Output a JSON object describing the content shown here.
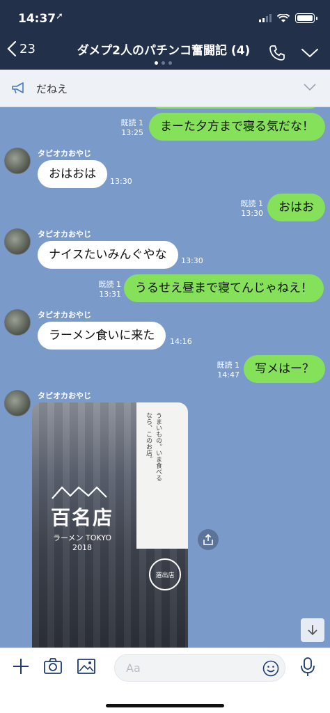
{
  "status": {
    "time": "14:37",
    "location_glyph": "➚"
  },
  "header": {
    "back_count": "23",
    "title": "ダメプ2人のパチンコ奮闘記 (4)"
  },
  "announcement": {
    "text": "だねえ"
  },
  "messages": [
    {
      "dir": "out",
      "read": "既読 1",
      "time": "13:25",
      "text": "まーた夕方まで寝る気だな！"
    },
    {
      "dir": "in",
      "sender": "タピオカおやじ",
      "time": "13:30",
      "text": "おはおは"
    },
    {
      "dir": "out",
      "read": "既読 1",
      "time": "13:30",
      "text": "おはお"
    },
    {
      "dir": "in",
      "sender": "タピオカおやじ",
      "time": "13:30",
      "text": "ナイスたいみんぐやな"
    },
    {
      "dir": "out",
      "read": "既読 1",
      "time": "13:31",
      "text": "うるせえ昼まで寝てんじゃねえ！"
    },
    {
      "dir": "in",
      "sender": "タピオカおやじ",
      "time": "14:16",
      "text": "ラーメン食いに来た"
    },
    {
      "dir": "out",
      "read": "既読 1",
      "time": "14:47",
      "text": "写メはー？"
    },
    {
      "dir": "in",
      "sender": "タピオカおやじ",
      "type": "photo"
    }
  ],
  "photo": {
    "logo_main": "百名店",
    "logo_sub": "ラーメン TOKYO",
    "logo_year": "2018",
    "card_text": "うまいもの。いま食べるなら、このお店。",
    "stamp": "選出店"
  },
  "input": {
    "placeholder": "Aa"
  },
  "icons": {
    "back": "chevron-left-icon",
    "phone": "phone-icon",
    "expand": "chevron-down-icon",
    "announcement": "megaphone-icon",
    "plus": "plus-icon",
    "camera": "camera-icon",
    "image": "image-icon",
    "emoji": "emoji-icon",
    "mic": "microphone-icon",
    "share": "share-icon",
    "scroll_down": "arrow-down-icon"
  },
  "colors": {
    "header_bg": "#22304a",
    "chat_bg": "#7a9bc9",
    "out_bubble": "#85e05a",
    "in_bubble": "#ffffff"
  }
}
